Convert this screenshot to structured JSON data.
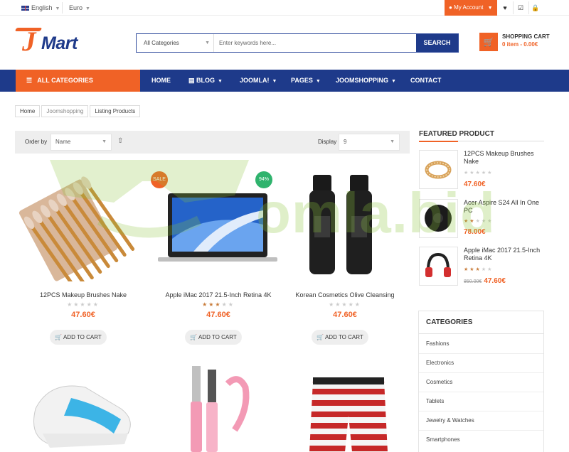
{
  "topbar": {
    "language": "English",
    "currency": "Euro",
    "my_account": "My Account",
    "icons": [
      "heart-icon",
      "checkbox-icon",
      "lock-icon"
    ]
  },
  "brand": {
    "logo_j": "J",
    "logo_rest": "Mart"
  },
  "search": {
    "category": "All Categories",
    "placeholder": "Enter keywords here...",
    "button": "SEARCH"
  },
  "cart": {
    "title": "SHOPPING CART",
    "info": "0 item - 0.00€"
  },
  "nav": {
    "all_categories": "ALL CATEGORIES",
    "items": [
      {
        "label": "HOME"
      },
      {
        "label": "BLOG"
      },
      {
        "label": "JOOMLA!"
      },
      {
        "label": "PAGES"
      },
      {
        "label": "JOOMSHOPPING"
      },
      {
        "label": "CONTACT"
      }
    ]
  },
  "breadcrumb": [
    "Home",
    "Joomshopping",
    "Listing Products"
  ],
  "toolbar": {
    "order_label": "Order by",
    "order_value": "Name",
    "display_label": "Display",
    "display_value": "9"
  },
  "products": [
    {
      "name": "12PCS Makeup Brushes Nake",
      "price": "47.60€",
      "rating": 0,
      "cart_label": "ADD TO CART"
    },
    {
      "name": "Apple iMac 2017 21.5-Inch Retina 4K",
      "price": "47.60€",
      "rating": 3,
      "cart_label": "ADD TO CART",
      "badge": "SALE"
    },
    {
      "name": "Korean Cosmetics Olive Cleansing",
      "price": "47.60€",
      "rating": 0,
      "cart_label": "ADD TO CART",
      "badge": "94%"
    }
  ],
  "sidebar": {
    "featured_title": "FEATURED PRODUCT",
    "featured": [
      {
        "name": "12PCS Makeup Brushes Nake",
        "price": "47.60€",
        "rating": 0
      },
      {
        "name": "Acer Aspire S24 All In One PC",
        "price": "78.00€",
        "rating": 2
      },
      {
        "name": "Apple iMac 2017 21.5-Inch Retina 4K",
        "price": "47.60€",
        "old_price": "850.00€",
        "rating": 3
      }
    ],
    "categories_title": "CATEGORIES",
    "categories": [
      "Fashions",
      "Electronics",
      "Cosmetics",
      "Tablets",
      "Jewelry & Watches",
      "Smartphones"
    ]
  },
  "watermark": "omla.bid",
  "colors": {
    "accent": "#f06226",
    "brand": "#1e3a8a",
    "badge_green": "#2fb36d"
  }
}
